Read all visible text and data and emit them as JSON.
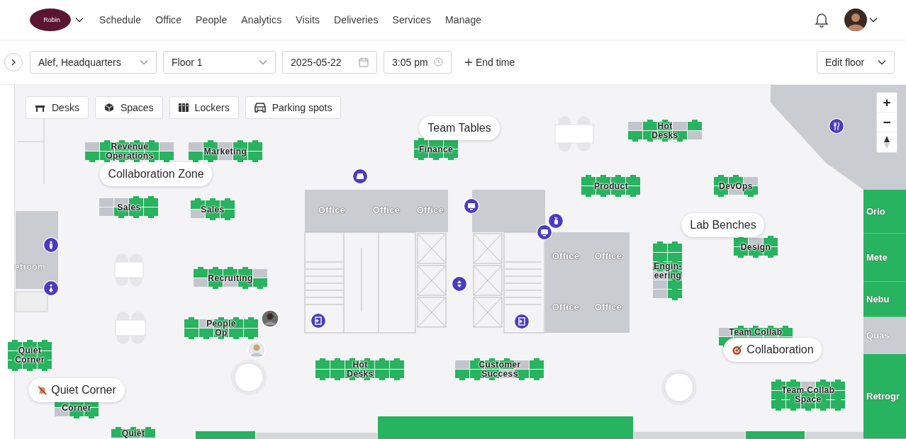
{
  "header": {
    "logo": "Robin",
    "nav": [
      "Schedule",
      "Office",
      "People",
      "Analytics",
      "Visits",
      "Deliveries",
      "Services",
      "Manage"
    ]
  },
  "toolbar": {
    "building": "Alef, Headquarters",
    "floor": "Floor 1",
    "date": "2025-05-22",
    "time": "3:05 pm",
    "end_time": "End time",
    "edit_floor": "Edit floor"
  },
  "filters": [
    {
      "label": "Desks",
      "kind": "desk"
    },
    {
      "label": "Spaces",
      "kind": "space"
    },
    {
      "label": "Lockers",
      "kind": "locker"
    },
    {
      "label": "Parking spots",
      "kind": "parking"
    }
  ],
  "map": {
    "neighborhoods": [
      "Revenue Operations",
      "Marketing",
      "Finance",
      "Hot Desks",
      "Sales",
      "Sales",
      "Product",
      "DevOps",
      "Design",
      "Recruiting",
      "Engin-eering",
      "People Op",
      "Team Collab",
      "Quiet Corner",
      "Hot Desks",
      "Customer Success",
      "Team Collab Space",
      "Corner",
      "Quiet"
    ],
    "offices": [
      "Office",
      "Office",
      "Office",
      "Office",
      "Office",
      "Office",
      "Office"
    ],
    "rooms": [
      {
        "label": "etroom",
        "available": false
      },
      {
        "label": "Orio",
        "available": true
      },
      {
        "label": "Mete",
        "available": true
      },
      {
        "label": "Nebu",
        "available": true
      },
      {
        "label": "Quas",
        "available": false
      },
      {
        "label": "Retrogr",
        "available": true
      }
    ],
    "callouts": [
      {
        "label": "Team Tables",
        "kind": "plain"
      },
      {
        "label": "Collaboration Zone",
        "kind": "plain"
      },
      {
        "label": "Lab Benches",
        "kind": "plain"
      },
      {
        "label": "Collaboration",
        "kind": "target"
      },
      {
        "label": "Quiet Corner",
        "kind": "muted"
      }
    ],
    "zoom": {
      "in": "+",
      "out": "−"
    }
  }
}
